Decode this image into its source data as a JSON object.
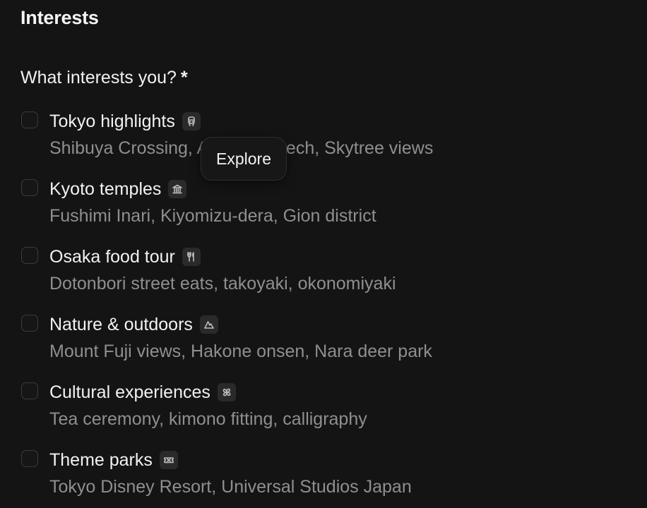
{
  "section": {
    "title": "Interests"
  },
  "question": {
    "text": "What interests you?",
    "required_marker": "*"
  },
  "options": [
    {
      "label": "Tokyo highlights",
      "icon": "train-icon",
      "description": "Shibuya Crossing, Akihabara tech, Skytree views",
      "checked": false
    },
    {
      "label": "Kyoto temples",
      "icon": "temple-icon",
      "description": "Fushimi Inari, Kiyomizu-dera, Gion district",
      "checked": false
    },
    {
      "label": "Osaka food tour",
      "icon": "utensils-icon",
      "description": "Dotonbori street eats, takoyaki, okonomiyaki",
      "checked": false
    },
    {
      "label": "Nature & outdoors",
      "icon": "mountain-icon",
      "description": "Mount Fuji views, Hakone onsen, Nara deer park",
      "checked": false
    },
    {
      "label": "Cultural experiences",
      "icon": "flower-icon",
      "description": "Tea ceremony, kimono fitting, calligraphy",
      "checked": false
    },
    {
      "label": "Theme parks",
      "icon": "ticket-icon",
      "description": "Tokyo Disney Resort, Universal Studios Japan",
      "checked": false
    }
  ],
  "tooltip": {
    "text": "Explore"
  },
  "colors": {
    "background": "#141414",
    "text_primary": "#f2f2f2",
    "text_secondary": "#8f8f8f",
    "checkbox_border": "#3b3b3b",
    "icon_chip": "#2a2a2a"
  }
}
